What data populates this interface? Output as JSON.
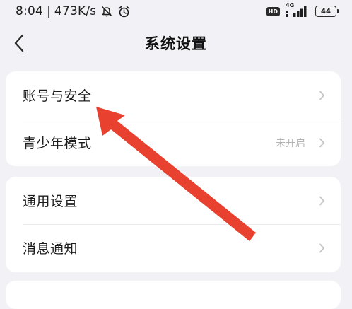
{
  "status_bar": {
    "time": "8:04",
    "separator": "|",
    "net_speed": "473K/s",
    "icons": [
      "mute-icon",
      "alarm-clock-icon",
      "hd-icon",
      "signal-icon",
      "battery-icon"
    ],
    "hd_label": "HD",
    "network_type": "4G",
    "battery_level": "44"
  },
  "header": {
    "back_icon": "back-arrow-icon",
    "title": "系统设置"
  },
  "settings": {
    "group1": [
      {
        "label": "账号与安全",
        "value": ""
      },
      {
        "label": "青少年模式",
        "value": "未开启"
      }
    ],
    "group2": [
      {
        "label": "通用设置",
        "value": ""
      },
      {
        "label": "消息通知",
        "value": ""
      }
    ]
  },
  "annotation": {
    "color": "#e8412f",
    "points_to": "账号与安全"
  },
  "colors": {
    "background": "#f2f2f6",
    "card": "#ffffff",
    "muted_text": "#b3b3b3",
    "chevron": "#c4c4c4"
  }
}
